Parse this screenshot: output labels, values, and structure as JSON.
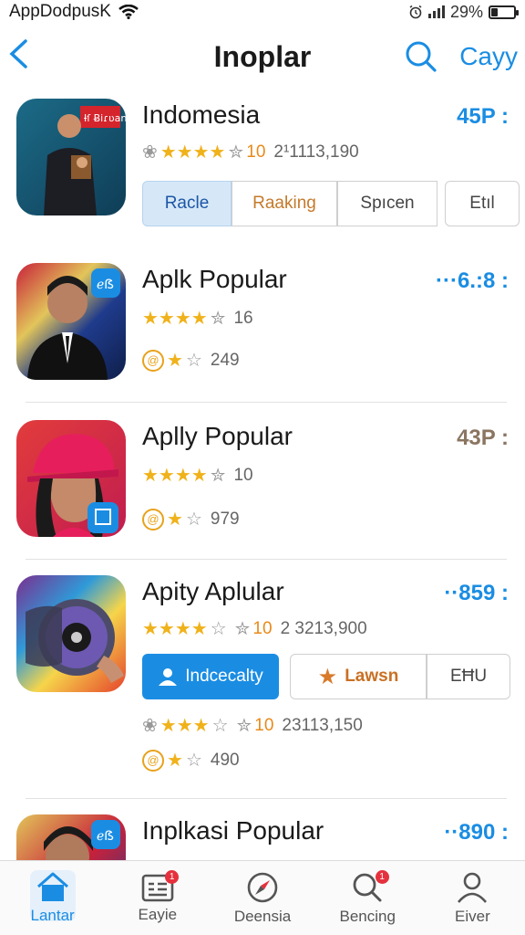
{
  "status_bar": {
    "carrier": "AppDodpusK",
    "battery": "29%",
    "battery_level": 0.29
  },
  "header": {
    "title": "Inoplar",
    "right_label": "Cayy"
  },
  "apps": [
    {
      "name": "Indomesia",
      "price": "45P :",
      "stars_label": "10",
      "count": "2¹1113,190",
      "tabs": [
        "Racle",
        "Raaking",
        "Spıcen",
        "Etıl"
      ],
      "icon_text": "Ɨſ Ƀiɾʋan"
    },
    {
      "name": "Aplk Popular",
      "price": "···6.:8 :",
      "stars_label": "16",
      "sub_count": "249"
    },
    {
      "name": "Aplly Popular",
      "price": "43P :",
      "stars_label": "10",
      "sub_count": "979"
    },
    {
      "name": "Apity Aplular",
      "price": "··859 :",
      "stars_label": "10",
      "count": "2 3213,900",
      "button_primary": "Indcecalty",
      "button_secondary": "Lawsn",
      "button_tertiary": "EĦU",
      "stars_label_2": "10",
      "count_2": "23113,150",
      "sub_count": "490"
    },
    {
      "name": "Inplkasi Popular",
      "price": "··890 :"
    }
  ],
  "nav": [
    {
      "label": "Lantar",
      "icon": "home-icon",
      "active": true
    },
    {
      "label": "Eayie",
      "icon": "news-icon",
      "badge": "1"
    },
    {
      "label": "Deensia",
      "icon": "compass-icon"
    },
    {
      "label": "Bencing",
      "icon": "search-icon",
      "badge": "1"
    },
    {
      "label": "Eiver",
      "icon": "user-icon"
    }
  ],
  "colors": {
    "accent": "#1a8de3",
    "star": "#f0b21b",
    "badge": "#e5313d"
  }
}
